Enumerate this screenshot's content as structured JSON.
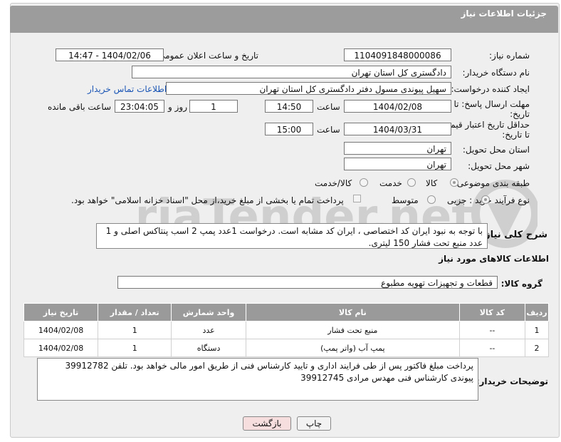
{
  "header": {
    "title": "جزئیات اطلاعات نیاز"
  },
  "fields": {
    "need_number_label": "شماره نیاز:",
    "need_number": "1104091848000086",
    "announce_label": "تاریخ و ساعت اعلان عمومی:",
    "announce_value": "1404/02/06 - 14:47",
    "buyer_org_label": "نام دستگاه خریدار:",
    "buyer_org": "دادگستری کل استان تهران",
    "requester_label": "ایجاد کننده درخواست:",
    "requester": "سهیل پیوندی مسول دفتر  دادگستری کل استان تهران",
    "contact_link": "اطلاعات تماس خریدار",
    "deadline_label": "مهلت ارسال پاسخ: تا تاریخ:",
    "deadline_date": "1404/02/08",
    "time_word": "ساعت",
    "deadline_time": "14:50",
    "days_value": "1",
    "days_word": "روز و",
    "remaining_time": "23:04:05",
    "remaining_word": "ساعت باقی مانده",
    "validity_label": "حداقل تاریخ اعتبار قیمت: تا تاریخ:",
    "validity_date": "1404/03/31",
    "validity_time": "15:00",
    "province_label": "استان محل تحویل:",
    "province": "تهران",
    "city_label": "شهر محل تحویل:",
    "city": "تهران",
    "category_label": "طبقه بندی موضوعی:",
    "category_options": [
      "کالا",
      "خدمت",
      "کالا/خدمت"
    ],
    "process_label": "نوع فرآیند خرید :",
    "process_options": [
      "جزیی",
      "متوسط"
    ],
    "payment_note": "پرداخت تمام یا بخشی از مبلغ خرید،از محل \"اسناد خزانه اسلامی\" خواهد بود."
  },
  "description": {
    "label": "شرح کلی نیاز:",
    "text": "با توجه به نبود ایران کد اختصاصی ، ایران کد مشابه است. درخواست 1عدد پمپ 2 اسب پنتاکس اصلی و 1 عدد منبع تحت فشار 150 لیتری."
  },
  "goods_info_title": "اطلاعات کالاهای مورد نیاز",
  "goods_group": {
    "label": "گروه کالا:",
    "value": "قطعات و تجهیزات تهویه مطبوع"
  },
  "table": {
    "headers": [
      "ردیف",
      "کد کالا",
      "نام کالا",
      "واحد شمارش",
      "تعداد / مقدار",
      "تاریخ نیاز"
    ],
    "rows": [
      [
        "1",
        "--",
        "منبع تحت فشار",
        "عدد",
        "1",
        "1404/02/08"
      ],
      [
        "2",
        "--",
        "پمپ آب (واتر پمپ)",
        "دستگاه",
        "1",
        "1404/02/08"
      ]
    ]
  },
  "buyer_notes": {
    "label": "توضیحات خریدار:",
    "text": "پرداخت مبلغ فاکتور پس از طی فرایند اداری و تایید کارشناس فنی از طریق امور مالی خواهد بود. تلفن 39912782 پیوندی کارشناس فنی مهدس مرادی 39912745"
  },
  "buttons": {
    "print": "چاپ",
    "back": "بازگشت"
  },
  "watermark": {
    "text": "AriaTender.net"
  },
  "colors": {
    "header_bg": "#9c9c9c",
    "panel_bg": "#efefef",
    "link": "#1a55b5",
    "back_btn_bg": "#f6dede"
  }
}
